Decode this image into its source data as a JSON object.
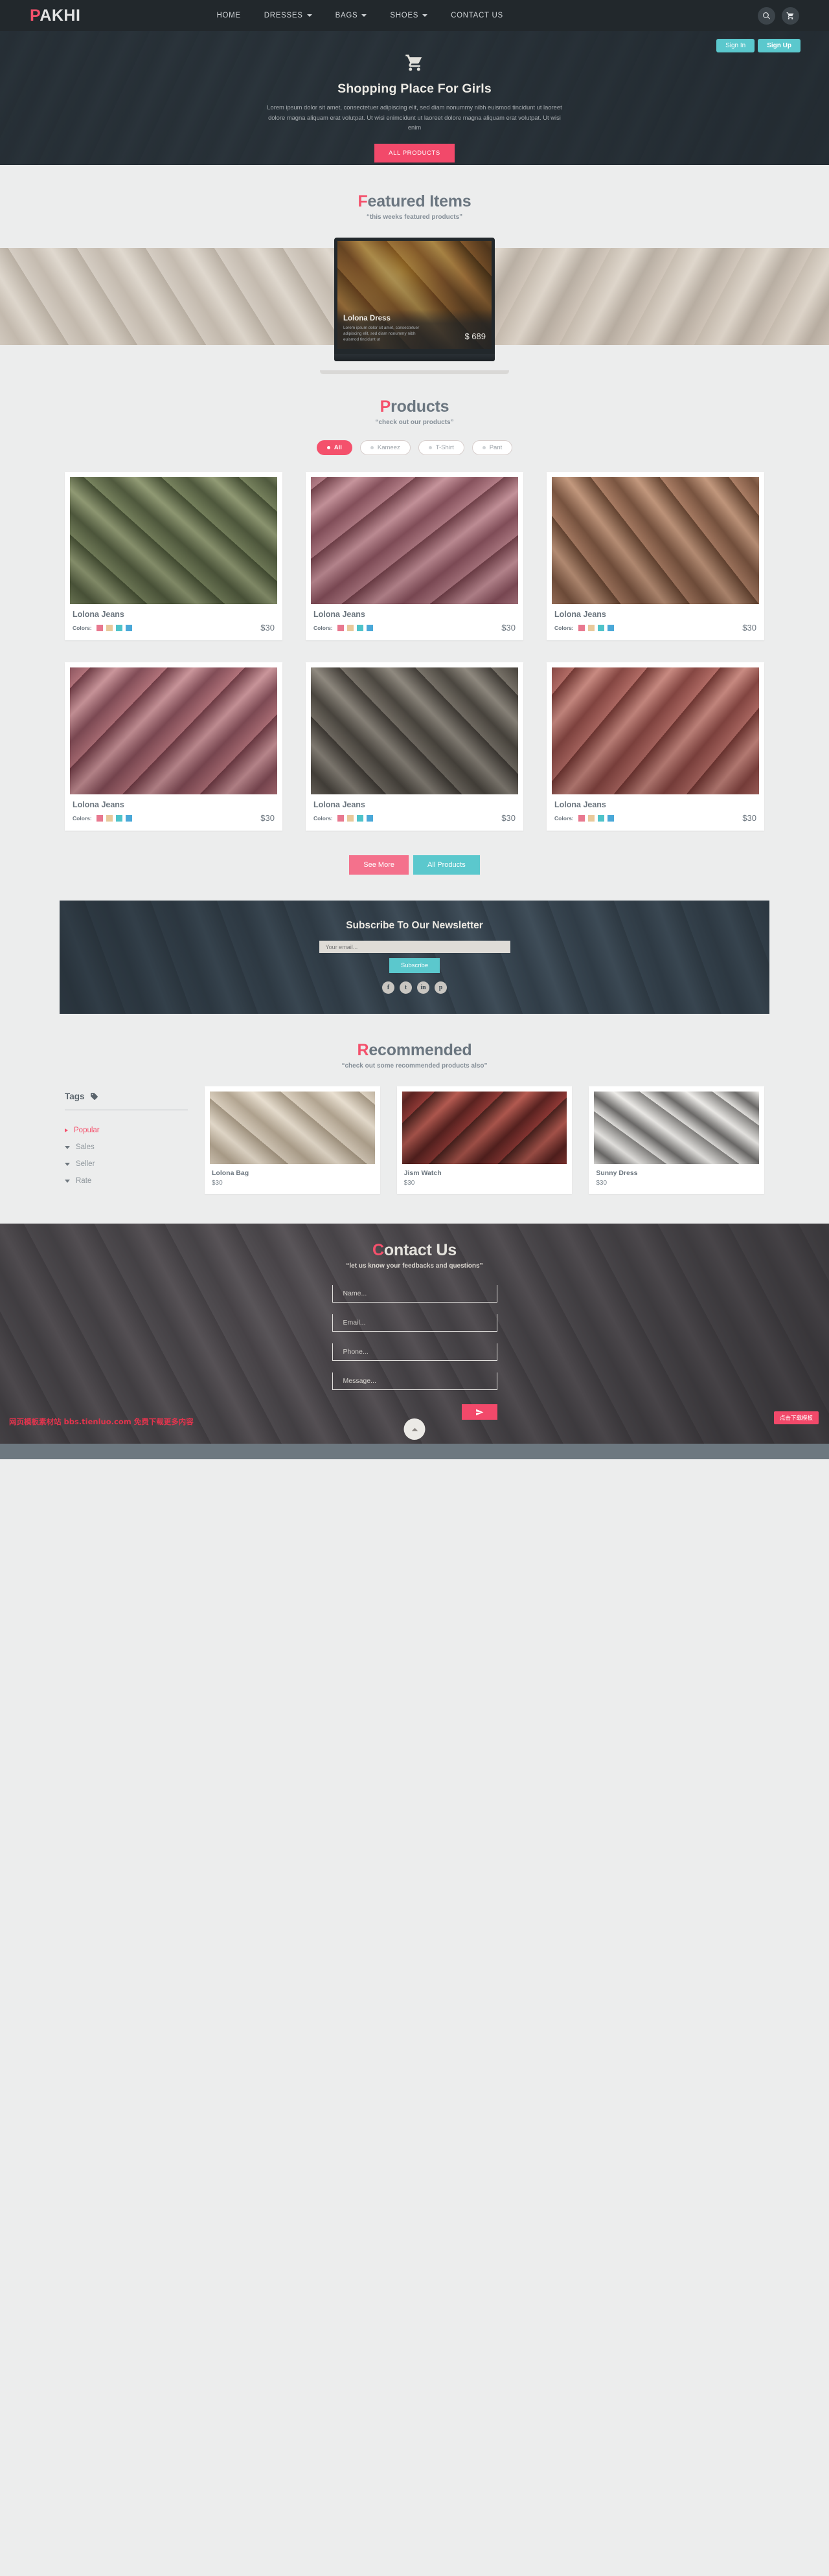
{
  "navbar": {
    "brand_first": "P",
    "brand_rest": "AKHI",
    "links": [
      {
        "label": "HOME",
        "caret": false
      },
      {
        "label": "DRESSES",
        "caret": true
      },
      {
        "label": "BAGS",
        "caret": true
      },
      {
        "label": "SHOES",
        "caret": true
      },
      {
        "label": "CONTACT US",
        "caret": false
      }
    ],
    "icons": [
      "search-icon",
      "cart-icon"
    ]
  },
  "hero": {
    "sign_in": "Sign In",
    "sign_up": "Sign Up",
    "icon": "shopping-cart-icon",
    "title": "Shopping Place For Girls",
    "description": "Lorem ipsum dolor sit amet, consectetuer adipiscing elit, sed diam nonummy nibh euismod tincidunt ut laoreet dolore magna aliquam erat volutpat. Ut wisi enimcidunt ut laoreet dolore magna aliquam erat volutpat. Ut wisi enim",
    "cta": "ALL PRODUCTS"
  },
  "featured": {
    "title_first": "F",
    "title_rest": "eatured Items",
    "subtitle": "“this weeks featured products”",
    "slide": {
      "name": "Lolona Dress",
      "description": "Lorem ipsum dolor sit amet, consectetuer adipiscing elit, sed diam nonummy nibh euismod tincidunt ut",
      "price": "$ 689"
    }
  },
  "products": {
    "title_first": "P",
    "title_rest": "roducts",
    "subtitle": "“check out our products”",
    "filters": [
      {
        "label": "All",
        "active": true
      },
      {
        "label": "Kameez",
        "active": false
      },
      {
        "label": "T-Shirt",
        "active": false
      },
      {
        "label": "Pant",
        "active": false
      }
    ],
    "colors_label": "Colors:",
    "swatches": [
      "#e8788f",
      "#e8c99b",
      "#4ec3c9",
      "#4aa8d8"
    ],
    "items": [
      {
        "name": "Lolona Jeans",
        "price": "$30"
      },
      {
        "name": "Lolona Jeans",
        "price": "$30"
      },
      {
        "name": "Lolona Jeans",
        "price": "$30"
      },
      {
        "name": "Lolona Jeans",
        "price": "$30"
      },
      {
        "name": "Lolona Jeans",
        "price": "$30"
      },
      {
        "name": "Lolona Jeans",
        "price": "$30"
      }
    ],
    "see_more": "See More",
    "all_products": "All Products"
  },
  "newsletter": {
    "title": "Subscribe To Our Newsletter",
    "placeholder": "Your email...",
    "button": "Subscribe",
    "socials": [
      {
        "name": "facebook-icon",
        "glyph": "f"
      },
      {
        "name": "twitter-icon",
        "glyph": "t"
      },
      {
        "name": "linkedin-icon",
        "glyph": "in"
      },
      {
        "name": "pinterest-icon",
        "glyph": "p"
      }
    ]
  },
  "recommended": {
    "title_first": "R",
    "title_rest": "ecommended",
    "subtitle": "“check out some recommended products also”",
    "tags_title": "Tags",
    "tags": [
      {
        "label": "Popular",
        "active": true
      },
      {
        "label": "Sales",
        "active": false
      },
      {
        "label": "Seller",
        "active": false
      },
      {
        "label": "Rate",
        "active": false
      }
    ],
    "items": [
      {
        "name": "Lolona Bag",
        "price": "$30"
      },
      {
        "name": "Jism Watch",
        "price": "$30"
      },
      {
        "name": "Sunny Dress",
        "price": "$30"
      }
    ]
  },
  "contact": {
    "title_first": "C",
    "title_rest": "ontact Us",
    "subtitle": "“let us know your feedbacks and questions”",
    "fields": [
      {
        "name": "name-field",
        "placeholder": "Name..."
      },
      {
        "name": "email-field",
        "placeholder": "Email..."
      },
      {
        "name": "phone-field",
        "placeholder": "Phone..."
      },
      {
        "name": "message-field",
        "placeholder": "Message..."
      }
    ],
    "send_icon": "paper-plane-icon"
  },
  "footer": {
    "watermark": "网页模板素材站 bbs.tienluo.com 免费下载更多内容",
    "download_badge": "点击下载模板",
    "to_top": "scroll-to-top-icon"
  },
  "colors": {
    "accent_pink": "#f4516c",
    "accent_teal": "#5bc8cd",
    "dark": "#22282c",
    "page_bg": "#eceded"
  }
}
